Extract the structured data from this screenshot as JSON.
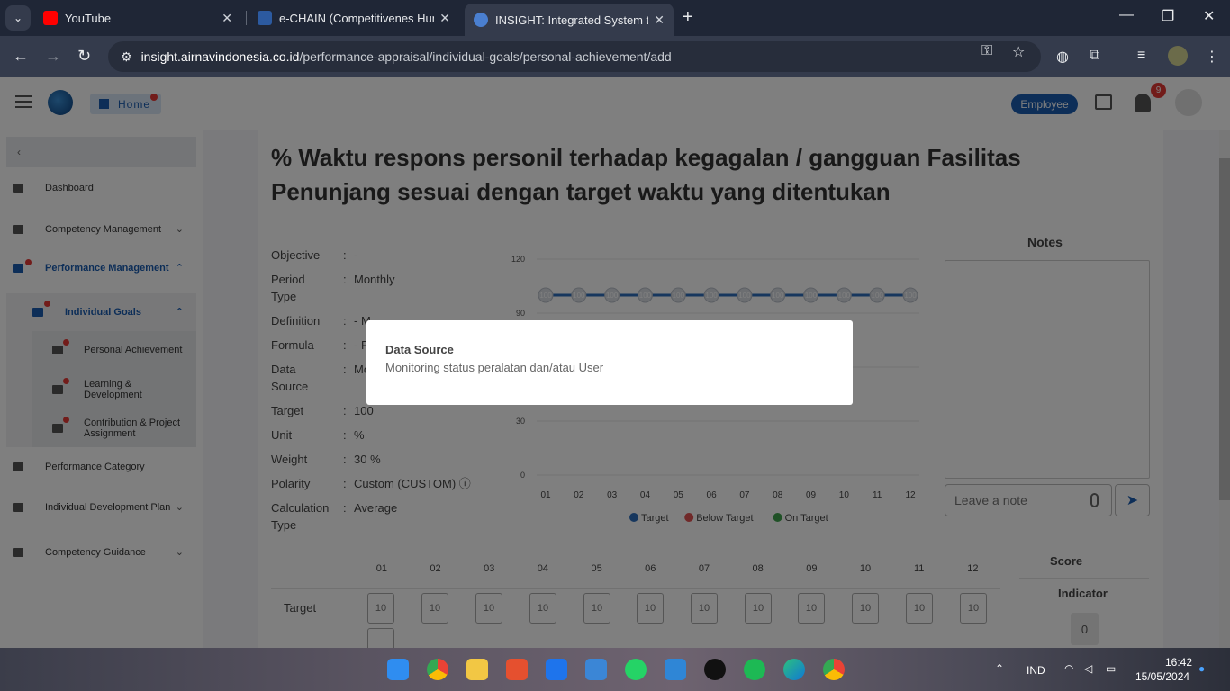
{
  "browser": {
    "tabs": [
      {
        "title": "YouTube",
        "active": false
      },
      {
        "title": "e-CHAIN (Competitivenes Hum",
        "active": false
      },
      {
        "title": "INSIGHT: Integrated System to",
        "active": true
      }
    ],
    "url_host": "insight.airnavindonesia.co.id",
    "url_path": "/performance-appraisal/individual-goals/personal-achievement/add"
  },
  "header": {
    "home_label": "Home",
    "role_badge": "Employee",
    "notification_count": "9"
  },
  "sidebar": {
    "collapse_symbol": "‹",
    "items": [
      {
        "label": "Dashboard"
      },
      {
        "label": "Competency Management"
      },
      {
        "label": "Performance Management"
      },
      {
        "label": "Individual Goals"
      },
      {
        "label": "Personal Achievement"
      },
      {
        "label": "Learning & Development"
      },
      {
        "label": "Contribution & Project Assignment"
      },
      {
        "label": "Performance Category"
      },
      {
        "label": "Individual Development Plan"
      },
      {
        "label": "Competency Guidance"
      }
    ]
  },
  "page": {
    "title": "% Waktu respons personil terhadap kegagalan / gangguan Fasilitas Penunjang sesuai dengan target waktu yang ditentukan",
    "info": [
      {
        "key": "Objective",
        "value": "-"
      },
      {
        "key": "Period Type",
        "value": "Monthly"
      },
      {
        "key": "Definition",
        "value": "- M"
      },
      {
        "key": "Formula",
        "value": "- F"
      },
      {
        "key": "Data Source",
        "value": "Mo"
      },
      {
        "key": "Target",
        "value": "100"
      },
      {
        "key": "Unit",
        "value": "%"
      },
      {
        "key": "Weight",
        "value": "30 %"
      },
      {
        "key": "Polarity",
        "value": "Custom (CUSTOM) ⓘ"
      },
      {
        "key": "Calculation Type",
        "value": "Average"
      }
    ],
    "notes_title": "Notes",
    "note_placeholder": "Leave a note",
    "months": [
      "01",
      "02",
      "03",
      "04",
      "05",
      "06",
      "07",
      "08",
      "09",
      "10",
      "11",
      "12"
    ],
    "target_row_label": "Target",
    "target_cell_value": "10",
    "score_title": "Score",
    "indicator_title": "Indicator",
    "score_value": "0"
  },
  "chart_data": {
    "type": "line",
    "categories": [
      "01",
      "02",
      "03",
      "04",
      "05",
      "06",
      "07",
      "08",
      "09",
      "10",
      "11",
      "12"
    ],
    "series": [
      {
        "name": "Target",
        "values": [
          100,
          100,
          100,
          100,
          100,
          100,
          100,
          100,
          100,
          100,
          100,
          100
        ],
        "color": "#2f6fbd"
      }
    ],
    "legend": [
      {
        "name": "Target",
        "color": "#2f6fbd"
      },
      {
        "name": "Below Target",
        "color": "#e05252"
      },
      {
        "name": "On Target",
        "color": "#3fa34d"
      }
    ],
    "y_ticks": [
      0,
      30,
      90,
      120
    ],
    "ylim": [
      0,
      120
    ],
    "legend_position": "bottom"
  },
  "modal": {
    "title": "Data Source",
    "body": "Monitoring status peralatan dan/atau User"
  },
  "taskbar": {
    "language": "IND",
    "time": "16:42",
    "date": "15/05/2024"
  },
  "colors": {
    "accent": "#1a5cb0",
    "danger": "#e53935"
  }
}
